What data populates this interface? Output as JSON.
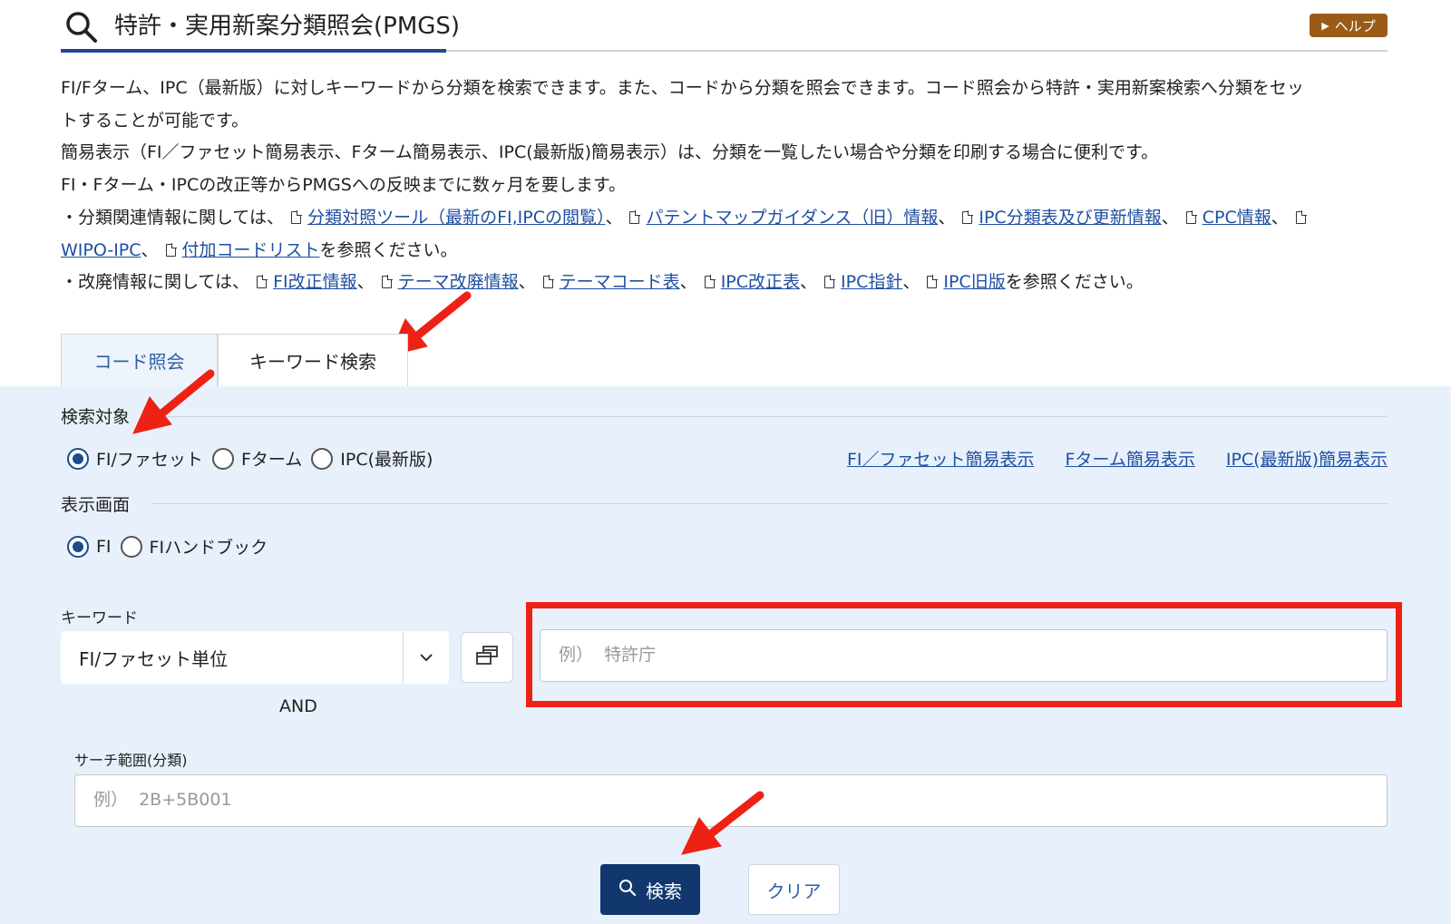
{
  "header": {
    "title": "特許・実用新案分類照会(PMGS)",
    "help_label": "ヘルプ"
  },
  "description": {
    "line1": "FI/Fターム、IPC（最新版）に対しキーワードから分類を検索できます。また、コードから分類を照会できます。コード照会から特許・実用新案検索へ分類をセッ",
    "line2": "トすることが可能です。",
    "line3": "簡易表示（FI／ファセット簡易表示、Fターム簡易表示、IPC(最新版)簡易表示）は、分類を一覧したい場合や分類を印刷する場合に便利です。",
    "line4": "FI・Fターム・IPCの改正等からPMGSへの反映までに数ヶ月を要します。",
    "related_prefix": "・分類関連情報に関しては、",
    "related_links": [
      "分類対照ツール（最新のFI,IPCの閲覧）",
      "パテントマップガイダンス（旧）情報",
      "IPC分類表及び更新情報",
      "CPC情報",
      "WIPO-IPC",
      "付加コードリスト"
    ],
    "related_suffix": "を参照ください。",
    "abolished_prefix": "・改廃情報に関しては、",
    "abolished_links": [
      "FI改正情報",
      "テーマ改廃情報",
      "テーマコード表",
      "IPC改正表",
      "IPC指針",
      "IPC旧版"
    ],
    "abolished_suffix": "を参照ください。",
    "separator": "、"
  },
  "tabs": {
    "code": "コード照会",
    "keyword": "キーワード検索"
  },
  "search_target": {
    "label": "検索対象",
    "options": [
      "FI/ファセット",
      "Fターム",
      "IPC(最新版)"
    ],
    "selected": "FI/ファセット",
    "simple_links": [
      "FI／ファセット簡易表示",
      "Fターム簡易表示",
      "IPC(最新版)簡易表示"
    ]
  },
  "display_screen": {
    "label": "表示画面",
    "options": [
      "FI",
      "FIハンドブック"
    ],
    "selected": "FI"
  },
  "keyword": {
    "label": "キーワード",
    "unit_selected": "FI/ファセット単位",
    "and_label": "AND",
    "placeholder": "例）  特許庁"
  },
  "search_range": {
    "label": "サーチ範囲(分類)",
    "placeholder": "例）  2B+5B001"
  },
  "buttons": {
    "search": "検索",
    "clear": "クリア"
  },
  "colors": {
    "primary": "#12366e",
    "link": "#1f4fa3",
    "panel_bg": "#e8f1fb",
    "help_bg": "#9a5b17",
    "annotation_red": "#ee2214"
  }
}
